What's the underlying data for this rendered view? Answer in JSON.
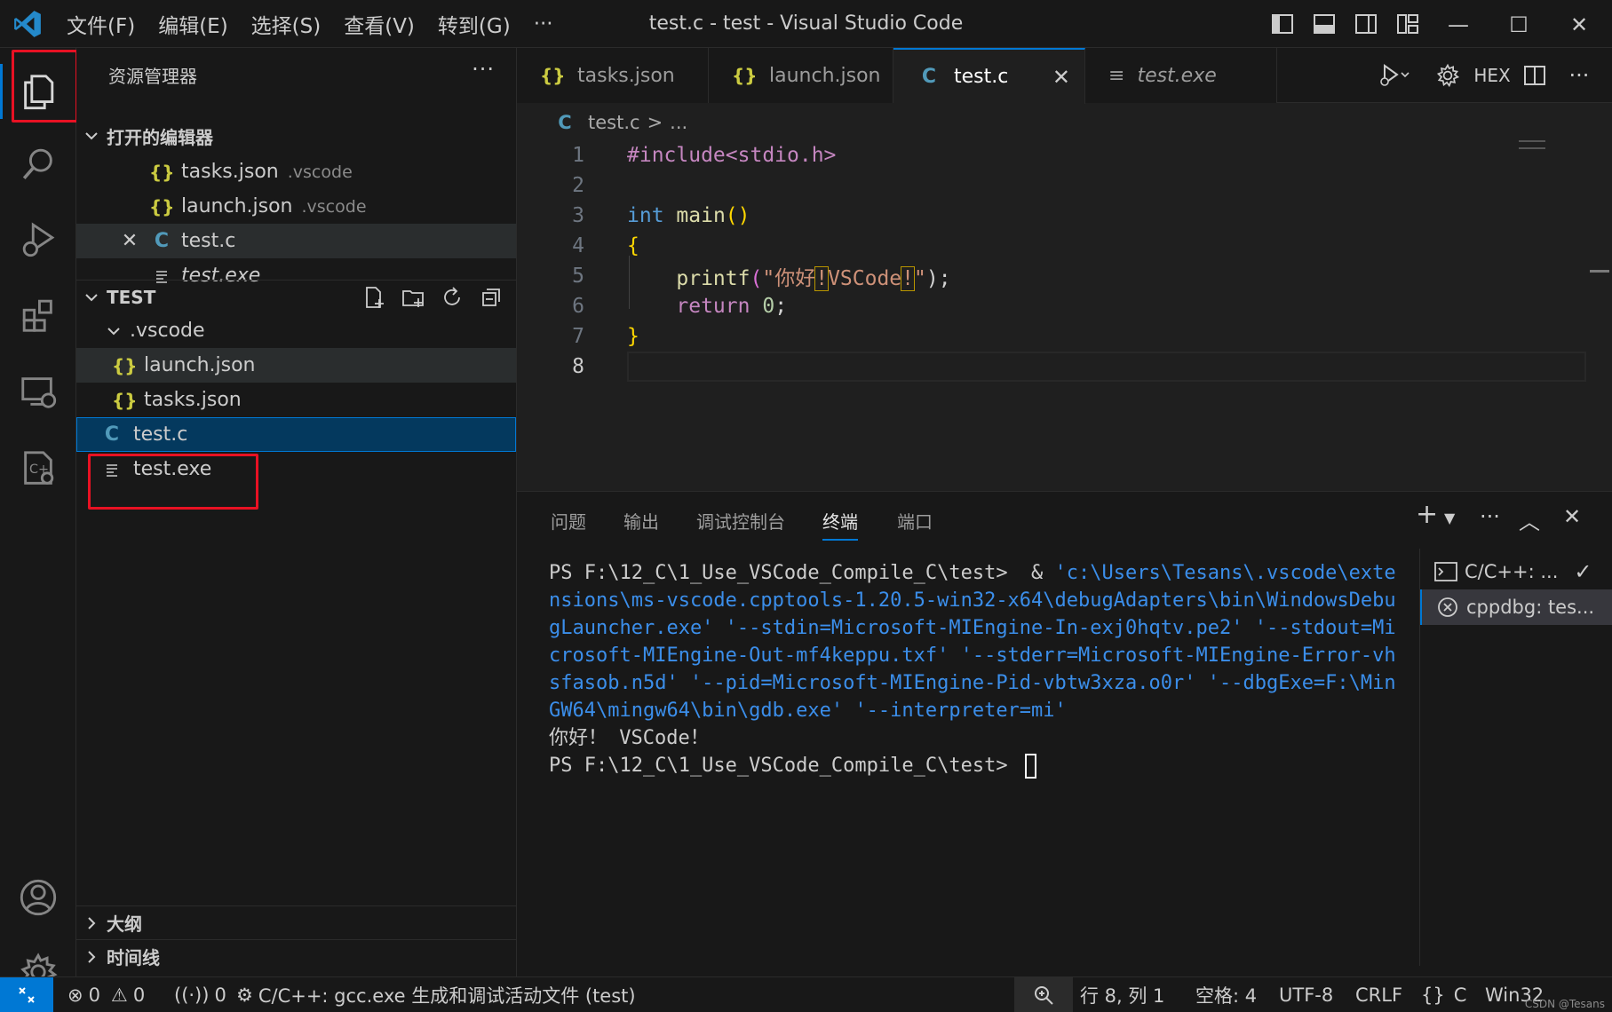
{
  "titlebar": {
    "menu": [
      "文件(F)",
      "编辑(E)",
      "选择(S)",
      "查看(V)",
      "转到(G)",
      "···"
    ],
    "title": "test.c - test - Visual Studio Code"
  },
  "sidebar": {
    "title": "资源管理器",
    "more": "···",
    "open_editors": {
      "header": "打开的编辑器",
      "items": [
        {
          "name": "tasks.json",
          "desc": ".vscode"
        },
        {
          "name": "launch.json",
          "desc": ".vscode"
        },
        {
          "name": "test.c"
        },
        {
          "name": "test.exe"
        }
      ]
    },
    "workspace": {
      "header": "TEST",
      "items": [
        {
          "name": ".vscode"
        },
        {
          "name": "launch.json"
        },
        {
          "name": "tasks.json"
        },
        {
          "name": "test.c"
        },
        {
          "name": "test.exe"
        }
      ]
    },
    "outline": "大纲",
    "timeline": "时间线"
  },
  "tabs": [
    {
      "label": "tasks.json",
      "icon": "{}"
    },
    {
      "label": "launch.json",
      "icon": "{}"
    },
    {
      "label": "test.c",
      "icon": "C"
    },
    {
      "label": "test.exe",
      "icon": "≡"
    }
  ],
  "editor_tools": {
    "hex": "HEX",
    "more": "···"
  },
  "breadcrumb": {
    "icon": "C",
    "file": "test.c",
    "sep": ">",
    "rest": "..."
  },
  "code": {
    "line_numbers": [
      "1",
      "2",
      "3",
      "4",
      "5",
      "6",
      "7",
      "8"
    ],
    "l1": "#include<stdio.h>",
    "l3_type": "int",
    "l3_fn": "main",
    "l3_paren": "()",
    "l4": "{",
    "l5_fn": "printf",
    "l5_open": "(",
    "l5_q1": "\"你好",
    "l5_ex1": "!",
    "l5_mid": "VSCode",
    "l5_ex2": "!",
    "l5_q2": "\"",
    "l5_close": ");",
    "l6_kw": "return",
    "l6_num": "0",
    "l6_semi": ";",
    "l7": "}"
  },
  "panel": {
    "tabs": [
      "问题",
      "输出",
      "调试控制台",
      "终端",
      "端口"
    ],
    "terminal": {
      "prompt1": "PS F:\\12_C\\1_Use_VSCode_Compile_C\\test>  & ",
      "cmd_lines": [
        "'c:\\Users\\Tesans\\.vscode\\exte",
        "nsions\\ms-vscode.cpptools-1.20.5-win32-x64\\debugAdapters\\bin\\WindowsDebu",
        "gLauncher.exe' '--stdin=Microsoft-MIEngine-In-exj0hqtv.pe2' '--stdout=Mi",
        "crosoft-MIEngine-Out-mf4keppu.txf' '--stderr=Microsoft-MIEngine-Error-vh",
        "sfasob.n5d' '--pid=Microsoft-MIEngine-Pid-vbtw3xza.o0r' '--dbgExe=F:\\Min",
        "GW64\\mingw64\\bin\\gdb.exe' '--interpreter=mi'"
      ],
      "output": "你好！ VSCode！",
      "prompt2": "PS F:\\12_C\\1_Use_VSCode_Compile_C\\test> "
    },
    "terminal_list": [
      {
        "label": "C/C++: ...",
        "check": "✓"
      },
      {
        "label": "cppdbg: tes..."
      }
    ]
  },
  "statusbar": {
    "errors": "0",
    "warnings": "0",
    "ports": "0",
    "task": "C/C++: gcc.exe 生成和调试活动文件 (test)",
    "position": "行 8, 列 1",
    "spaces": "空格: 4",
    "encoding": "UTF-8",
    "eol": "CRLF",
    "lang_icon": "{}",
    "language": "C",
    "platform": "Win32",
    "watermark": "CSDN @Tesans"
  },
  "colors": {
    "accent": "#0078d4",
    "highlight_box": "#e81123"
  }
}
